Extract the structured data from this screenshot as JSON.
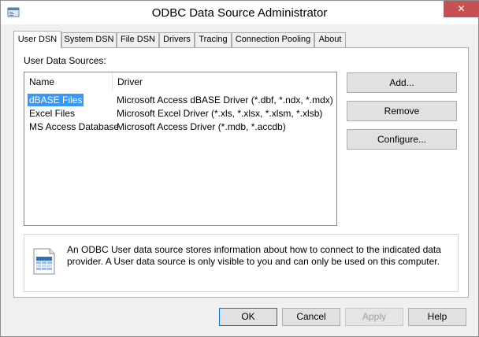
{
  "window": {
    "title": "ODBC Data Source Administrator",
    "close_glyph": "✕",
    "app_icon": "odbc-app-icon"
  },
  "tabs": [
    {
      "label": "User DSN",
      "active": true
    },
    {
      "label": "System DSN",
      "active": false
    },
    {
      "label": "File DSN",
      "active": false
    },
    {
      "label": "Drivers",
      "active": false
    },
    {
      "label": "Tracing",
      "active": false
    },
    {
      "label": "Connection Pooling",
      "active": false
    },
    {
      "label": "About",
      "active": false
    }
  ],
  "panel": {
    "section_label": "User Data Sources:",
    "columns": [
      "Name",
      "Driver"
    ],
    "rows": [
      {
        "name": "dBASE Files",
        "driver": "Microsoft Access dBASE Driver (*.dbf, *.ndx, *.mdx)",
        "selected": true
      },
      {
        "name": "Excel Files",
        "driver": "Microsoft Excel Driver (*.xls, *.xlsx, *.xlsm, *.xlsb)",
        "selected": false
      },
      {
        "name": "MS Access Database",
        "driver": "Microsoft Access Driver (*.mdb, *.accdb)",
        "selected": false
      }
    ],
    "buttons": {
      "add": "Add...",
      "remove": "Remove",
      "configure": "Configure..."
    },
    "info": {
      "icon": "database-document-icon",
      "text": "An ODBC User data source stores information about how to connect to the indicated data provider.   A User data source is only visible to you and can only be used on this computer."
    }
  },
  "footer": {
    "ok": "OK",
    "cancel": "Cancel",
    "apply": "Apply",
    "help": "Help"
  },
  "colors": {
    "selection": "#3399ff",
    "close_button": "#c75050",
    "focus_border": "#0078d7"
  }
}
